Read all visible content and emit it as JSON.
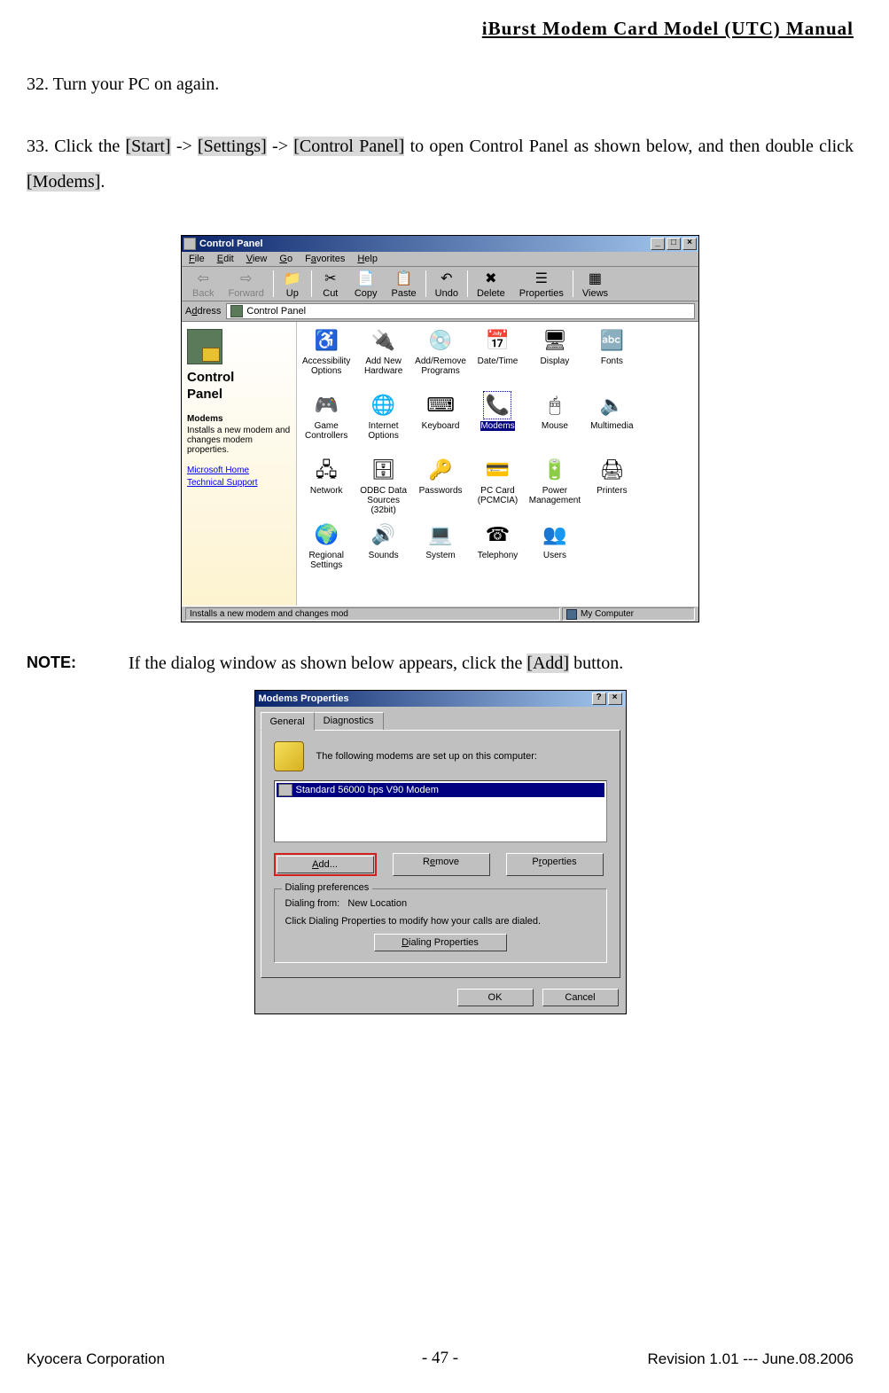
{
  "header": {
    "title": "iBurst  Modem  Card  Model  (UTC)  Manual"
  },
  "steps": {
    "s32": {
      "num": "32.",
      "text": "Turn your PC on again."
    },
    "s33": {
      "num": "33.",
      "pre": "Click the ",
      "start": "[Start]",
      "arrow1": " -> ",
      "settings": "[Settings]",
      "arrow2": " -> ",
      "cpanel": "[Control Panel]",
      "mid": " to open Control Panel as shown below, and then double click ",
      "modems": "[Modems]",
      "end": "."
    }
  },
  "note": {
    "label": "NOTE:",
    "pre": "If the dialog window as shown below appears, click the ",
    "add": "[Add]",
    "post": " button."
  },
  "cp": {
    "title": "Control Panel",
    "menus": {
      "file": "File",
      "edit": "Edit",
      "view": "View",
      "go": "Go",
      "fav": "Favorites",
      "help": "Help"
    },
    "toolbar": {
      "back": "Back",
      "forward": "Forward",
      "up": "Up",
      "cut": "Cut",
      "copy": "Copy",
      "paste": "Paste",
      "undo": "Undo",
      "delete": "Delete",
      "props": "Properties",
      "views": "Views"
    },
    "addr_label": "Address",
    "addr_text": "Control Panel",
    "side": {
      "title": "Control",
      "subtitle": "Panel",
      "sec": "Modems",
      "desc": "Installs a new modem and changes modem properties.",
      "link1": "Microsoft Home",
      "link2": "Technical Support"
    },
    "icons": [
      "Accessibility Options",
      "Add New Hardware",
      "Add/Remove Programs",
      "Date/Time",
      "Display",
      "Fonts",
      "",
      "Game Controllers",
      "Internet Options",
      "Keyboard",
      "Modems",
      "Mouse",
      "Multimedia",
      "",
      "Network",
      "ODBC Data Sources (32bit)",
      "Passwords",
      "PC Card (PCMCIA)",
      "Power Management",
      "Printers",
      "",
      "Regional Settings",
      "Sounds",
      "System",
      "Telephony",
      "Users",
      "",
      ""
    ],
    "glyphs": [
      "♿",
      "🔌",
      "💿",
      "📅",
      "🖥",
      "🔤",
      "",
      "🎮",
      "🌐",
      "⌨",
      "📞",
      "🖱",
      "🔈",
      "",
      "🖧",
      "🗄",
      "🔑",
      "💳",
      "🔋",
      "🖨",
      "",
      "🌍",
      "🔊",
      "💻",
      "☎",
      "👥",
      "",
      ""
    ],
    "selected_index": 10,
    "status_main": "Installs a new modem and changes mod",
    "status_side": "My Computer"
  },
  "mp": {
    "title": "Modems Properties",
    "tabs": {
      "general": "General",
      "diag": "Diagnostics"
    },
    "intro": "The following modems are set up on this computer:",
    "list_item": "Standard 56000 bps V90 Modem",
    "btn_add": "Add...",
    "btn_remove": "Remove",
    "btn_props": "Properties",
    "group_legend": "Dialing preferences",
    "dial_from_label": "Dialing from:",
    "dial_from_value": "New Location",
    "dial_hint": "Click Dialing Properties to modify how your calls are dialed.",
    "btn_dialprops": "Dialing Properties",
    "btn_ok": "OK",
    "btn_cancel": "Cancel"
  },
  "footer": {
    "left": "Kyocera Corporation",
    "center": "- 47 -",
    "right": "Revision 1.01 --- June.08.2006"
  }
}
